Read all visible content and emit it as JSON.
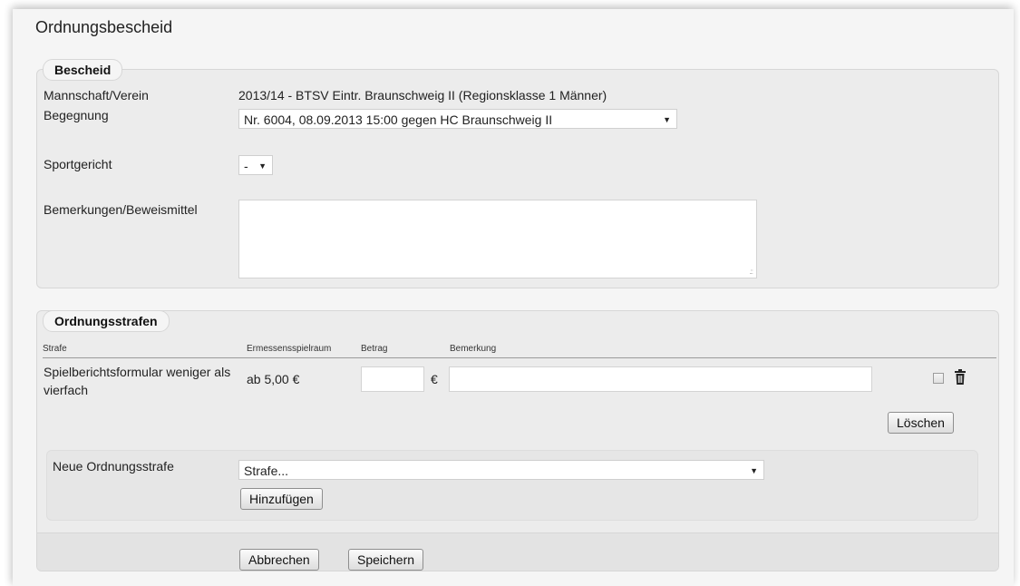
{
  "page_title": "Ordnungsbescheid",
  "bescheid": {
    "legend": "Bescheid",
    "team_label": "Mannschaft/Verein",
    "team_value": "2013/14 - BTSV Eintr. Braunschweig II (Regionsklasse 1 Männer)",
    "match_label": "Begegnung",
    "match_value": "Nr. 6004, 08.09.2013 15:00 gegen HC Braunschweig II",
    "court_label": "Sportgericht",
    "court_value": "-",
    "remarks_label": "Bemerkungen/Beweismittel",
    "remarks_value": ""
  },
  "penalties": {
    "legend": "Ordnungsstrafen",
    "columns": [
      "Strafe",
      "Ermessensspielraum",
      "Betrag",
      "Bemerkung"
    ],
    "rows": [
      {
        "strafe": "Spielberichtsformular weniger als vierfach",
        "ermessen": "ab 5,00 €",
        "betrag": "",
        "currency": "€",
        "bemerkung": "",
        "checked": false
      }
    ],
    "delete_button": "Löschen",
    "new_label": "Neue Ordnungsstrafe",
    "new_select": "Strafe...",
    "add_button": "Hinzufügen"
  },
  "footer": {
    "cancel_button": "Abbrechen",
    "save_button": "Speichern"
  },
  "icons": {
    "caret": "chevron-down-icon",
    "delete": "trash-icon"
  }
}
